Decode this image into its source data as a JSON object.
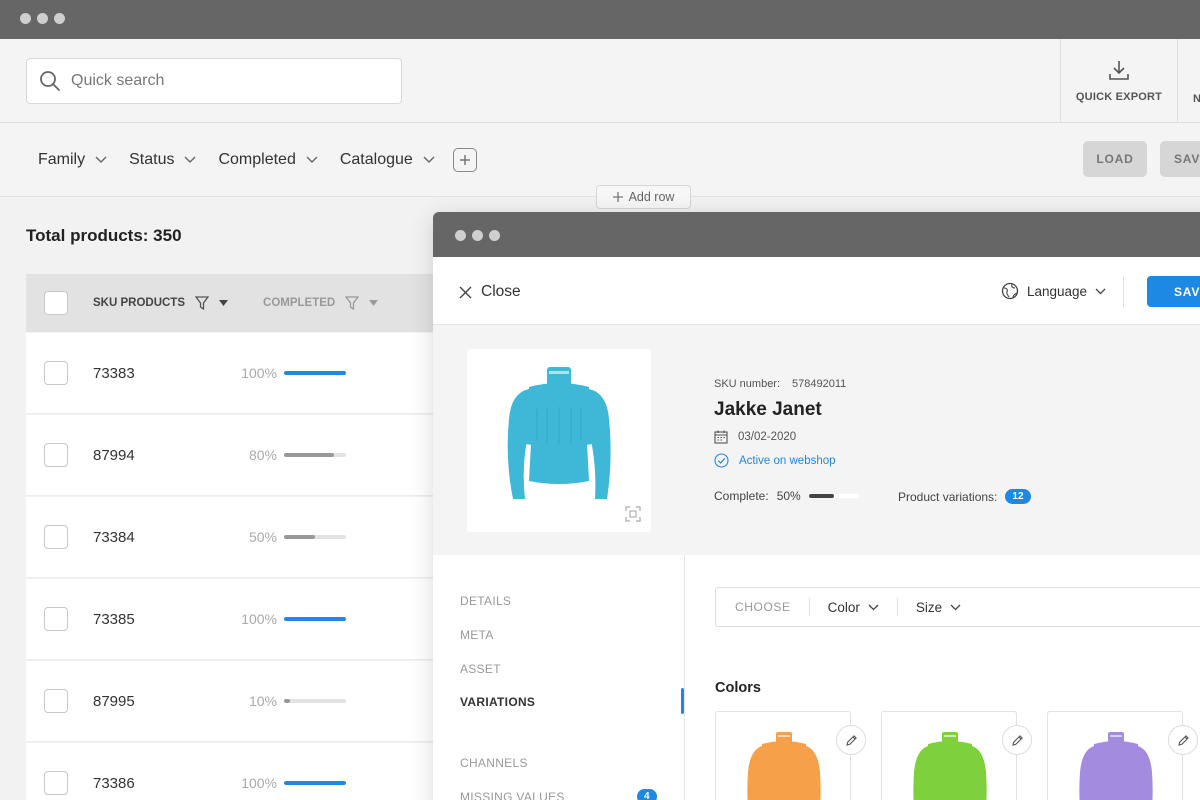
{
  "search": {
    "placeholder": "Quick search"
  },
  "toolbar": {
    "quick_export": "QUICK EXPORT",
    "next_truncated": "N"
  },
  "filters": [
    "Family",
    "Status",
    "Completed",
    "Catalogue"
  ],
  "filter_actions": {
    "load": "LOAD",
    "save": "SAVE"
  },
  "add_row": "Add row",
  "total_products": "Total products: 350",
  "table": {
    "columns": [
      "SKU PRODUCTS",
      "COMPLETED"
    ],
    "rows": [
      {
        "sku": "73383",
        "completed": "100%",
        "fraction": 1.0,
        "color": "#1e88e5"
      },
      {
        "sku": "87994",
        "completed": "80%",
        "fraction": 0.8,
        "color": "#999999"
      },
      {
        "sku": "73384",
        "completed": "50%",
        "fraction": 0.5,
        "color": "#999999"
      },
      {
        "sku": "73385",
        "completed": "100%",
        "fraction": 1.0,
        "color": "#1e88e5"
      },
      {
        "sku": "87995",
        "completed": "10%",
        "fraction": 0.1,
        "color": "#999999"
      },
      {
        "sku": "73386",
        "completed": "100%",
        "fraction": 1.0,
        "color": "#1e88e5"
      }
    ]
  },
  "modal": {
    "close_label": "Close",
    "language_label": "Language",
    "save_label": "SAVE",
    "sku_label": "SKU number:",
    "sku_value": "578492011",
    "product_name": "Jakke Janet",
    "date": "03/02-2020",
    "status": "Active on webshop",
    "complete_label": "Complete:",
    "complete_value": "50%",
    "complete_fraction": 0.5,
    "variations_label": "Product variations:",
    "variations_count": "12",
    "nav": [
      "DETAILS",
      "META",
      "ASSET",
      "VARIATIONS",
      "CHANNELS",
      "MISSING VALUES"
    ],
    "nav_active": "VARIATIONS",
    "missing_values_count": "4",
    "choose_label": "CHOOSE",
    "choose_options": [
      "Color",
      "Size"
    ],
    "colors_title": "Colors",
    "swatch_colors": [
      "#f7a04a",
      "#7fd03d",
      "#a38be0"
    ]
  },
  "colors": {
    "accent": "#1e88e5",
    "product_main": "#3fb7d6"
  },
  "icons": [
    "search-icon",
    "download-icon",
    "chevron-down-icon",
    "plus-icon",
    "filter-icon",
    "sort-down-icon",
    "close-icon",
    "globe-icon",
    "calendar-icon",
    "check-circle-icon",
    "zoom-icon",
    "pencil-icon"
  ]
}
